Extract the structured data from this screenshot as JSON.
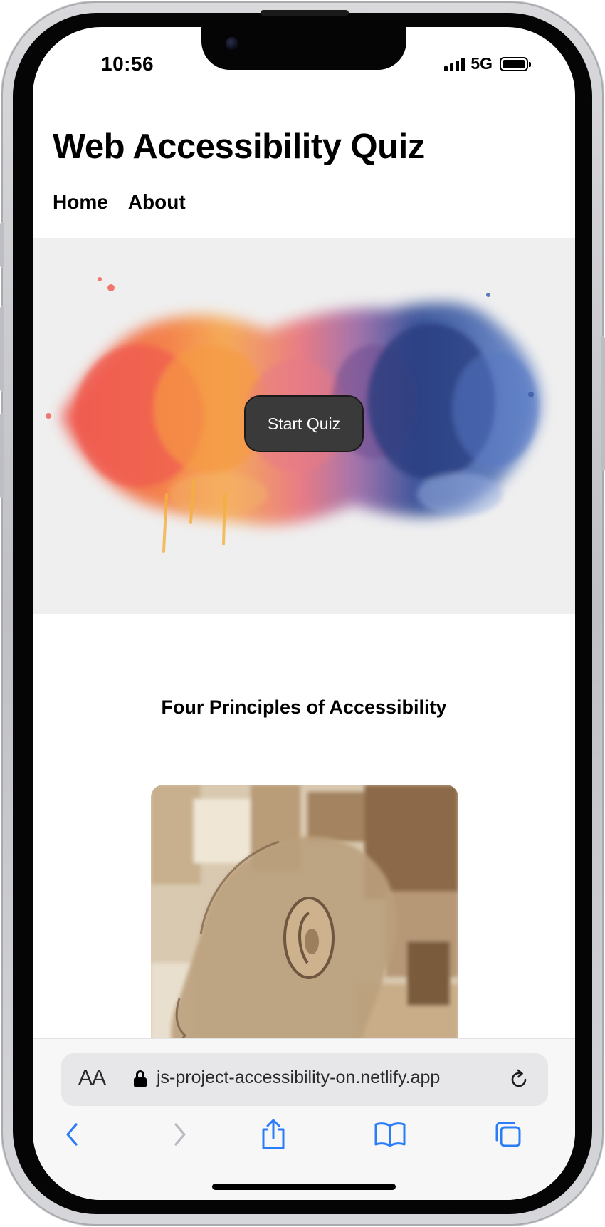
{
  "status_bar": {
    "time": "10:56",
    "network": "5G",
    "battery_icon": "battery-full-icon",
    "signal_icon": "cellular-signal-icon"
  },
  "site": {
    "title": "Web Accessibility Quiz",
    "nav": [
      {
        "label": "Home"
      },
      {
        "label": "About"
      }
    ]
  },
  "hero": {
    "cta_label": "Start Quiz",
    "image": "watercolor-splash-image"
  },
  "principles": {
    "heading": "Four Principles of Accessibility",
    "card_image": "watercolor-head-ear-image"
  },
  "browser": {
    "text_size_label": "AA",
    "url": "js-project-accessibility-on.netlify.app",
    "icons": {
      "lock": "lock-icon",
      "reload": "reload-icon",
      "back": "chevron-left-icon",
      "forward": "chevron-right-icon",
      "share": "share-icon",
      "bookmarks": "book-icon",
      "tabs": "tabs-icon"
    },
    "accent_color": "#2b7cf7",
    "disabled_color": "#b9bbc0"
  }
}
